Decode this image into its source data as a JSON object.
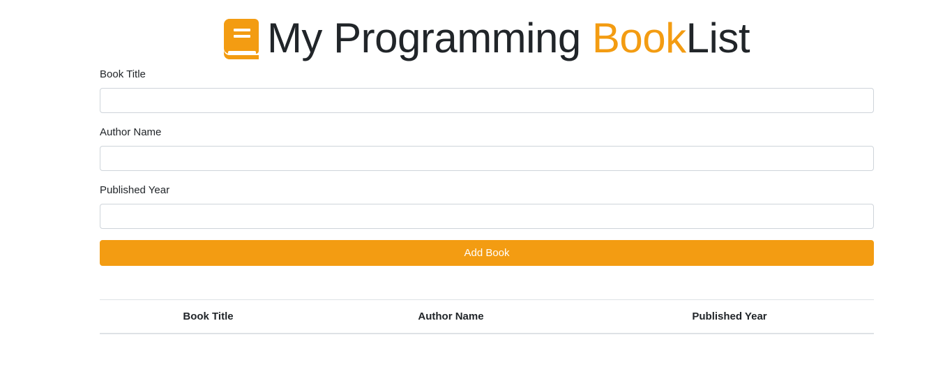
{
  "header": {
    "title_main": "My Programming ",
    "title_accent": "Book",
    "title_end": "List",
    "icon": "book-icon",
    "accent_color": "#f39c12"
  },
  "form": {
    "fields": [
      {
        "label": "Book Title",
        "value": "",
        "placeholder": ""
      },
      {
        "label": "Author Name",
        "value": "",
        "placeholder": ""
      },
      {
        "label": "Published Year",
        "value": "",
        "placeholder": ""
      }
    ],
    "submit_label": "Add Book"
  },
  "table": {
    "headers": [
      "Book Title",
      "Author Name",
      "Published Year"
    ],
    "rows": []
  }
}
